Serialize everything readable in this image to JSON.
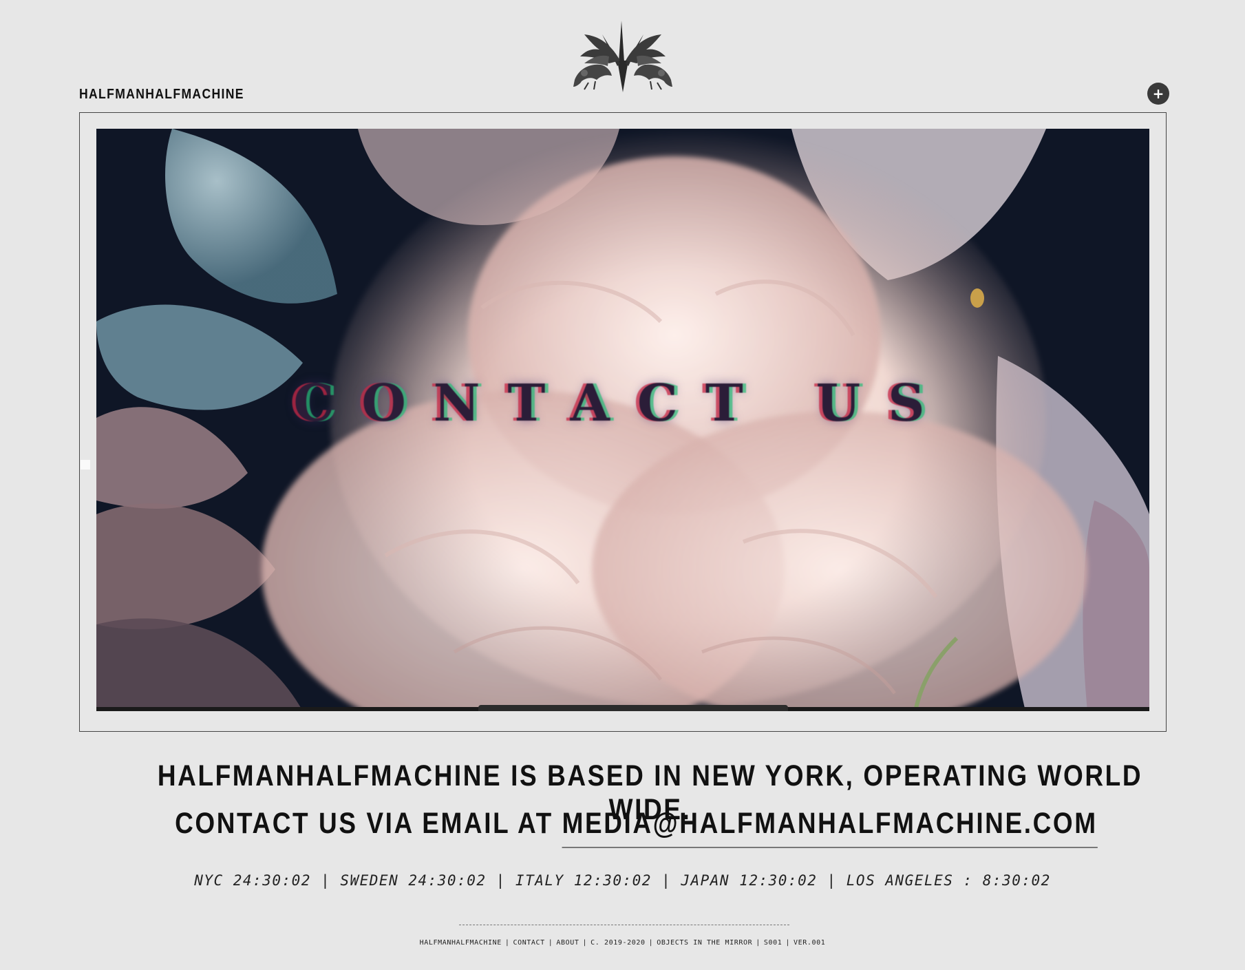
{
  "header": {
    "brand": "HALFMANHALFMACHINE",
    "logo_icon": "winged-beasts-emblem-icon",
    "menu_icon": "plus-icon",
    "menu_symbol": "+"
  },
  "hero": {
    "title": "CONTACT US",
    "palette": {
      "background": "#0f1626",
      "petal_light": "#f6e6e0",
      "petal_blush": "#e8c2bb",
      "petal_blue": "#8fb1c0"
    }
  },
  "contact": {
    "line1": "HALFMANHALFMACHINE IS BASED IN NEW YORK, OPERATING WORLD WIDE.",
    "line2_prefix": "CONTACT US VIA EMAIL AT ",
    "email": "MEDIA@HALFMANHALFMACHINE.COM"
  },
  "clocks": "NYC 24:30:02 | SWEDEN 24:30:02 | ITALY 12:30:02 | JAPAN 12:30:02 | LOS ANGELES : 8:30:02",
  "footer": {
    "divider": "--------------------------------------------------------------------------------",
    "items": [
      "HALFMANHALFMACHINE",
      "CONTACT",
      "ABOUT",
      "C. 2019-2020",
      "OBJECTS IN THE MIRROR",
      "S001",
      "VER.001"
    ]
  }
}
